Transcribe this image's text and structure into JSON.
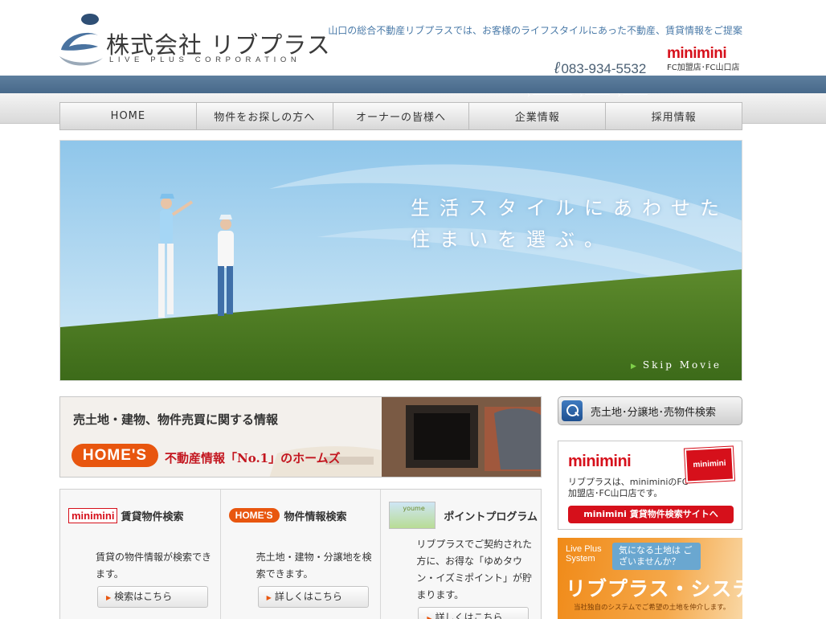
{
  "header": {
    "company_name": "株式会社 リブプラス",
    "company_name_en": "LIVE PLUS CORPORATION",
    "tagline": "山口の総合不動産リブプラスでは、お客様のライフスタイルにあった不動産、賃貸情報をご提案",
    "phone": "083-934-5532",
    "franchise_logo": "minimini",
    "franchise_label": "FC加盟店･FC山口店"
  },
  "nav": {
    "items": [
      {
        "label": "HOME"
      },
      {
        "label": "物件をお探しの方へ"
      },
      {
        "label": "オーナーの皆様へ"
      },
      {
        "label": "企業情報"
      },
      {
        "label": "採用情報"
      }
    ]
  },
  "hero": {
    "line1": "生活スタイルにあわせた",
    "line2": "住まいを選ぶ。",
    "skip": "Skip Movie"
  },
  "homes_banner": {
    "title": "売土地・建物、物件売買に関する情報",
    "logo": "HOME'S",
    "caption": "不動産情報「No.1」のホームズ"
  },
  "columns": [
    {
      "badge": "minimini",
      "title": "賃貸物件検索",
      "text": "賃貸の物件情報が検索できます。",
      "button": "検索はこちら"
    },
    {
      "badge": "HOME'S",
      "title": "物件情報検索",
      "text": "売土地・建物・分譲地を検索できます。",
      "button": "詳しくはこちら"
    },
    {
      "badge": "youme",
      "title": "ポイントプログラム",
      "text": "リブプラスでご契約された方に、お得な「ゆめタウン・イズミポイント」が貯まります。",
      "button": "詳しくはこちら"
    }
  ],
  "side": {
    "search_label": "売土地･分譲地･売物件検索",
    "mm_logo": "minimini",
    "mm_text": "リブプラスは、miniminiのFC加盟店･FC山口店です。",
    "mm_sign": "minimini",
    "mm_button": "minimini 賃貸物件検索サイトへ",
    "lp_tag": "Live Plus System",
    "lp_bubble": "気になる土地は ございませんか？",
    "lp_title": "リブプラス・システム",
    "lp_sub": "当社独自のシステムでご希望の土地を仲介します。"
  },
  "colors": {
    "band_blue": "#4f7192",
    "accent_red": "#d6101b",
    "homes_orange": "#e8560f",
    "tagline_blue": "#4a7aa8"
  },
  "icons": [
    "logo-mark-icon",
    "phone-icon",
    "search-icon",
    "arrow-right-icon"
  ]
}
